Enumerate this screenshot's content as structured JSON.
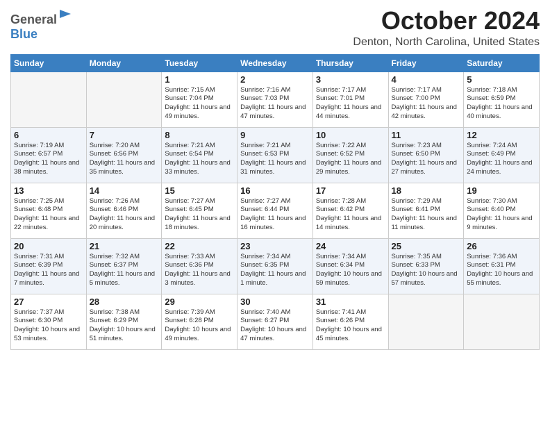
{
  "header": {
    "logo_general": "General",
    "logo_blue": "Blue",
    "month_title": "October 2024",
    "location": "Denton, North Carolina, United States"
  },
  "weekdays": [
    "Sunday",
    "Monday",
    "Tuesday",
    "Wednesday",
    "Thursday",
    "Friday",
    "Saturday"
  ],
  "weeks": [
    [
      {
        "day": "",
        "info": ""
      },
      {
        "day": "",
        "info": ""
      },
      {
        "day": "1",
        "info": "Sunrise: 7:15 AM\nSunset: 7:04 PM\nDaylight: 11 hours and 49 minutes."
      },
      {
        "day": "2",
        "info": "Sunrise: 7:16 AM\nSunset: 7:03 PM\nDaylight: 11 hours and 47 minutes."
      },
      {
        "day": "3",
        "info": "Sunrise: 7:17 AM\nSunset: 7:01 PM\nDaylight: 11 hours and 44 minutes."
      },
      {
        "day": "4",
        "info": "Sunrise: 7:17 AM\nSunset: 7:00 PM\nDaylight: 11 hours and 42 minutes."
      },
      {
        "day": "5",
        "info": "Sunrise: 7:18 AM\nSunset: 6:59 PM\nDaylight: 11 hours and 40 minutes."
      }
    ],
    [
      {
        "day": "6",
        "info": "Sunrise: 7:19 AM\nSunset: 6:57 PM\nDaylight: 11 hours and 38 minutes."
      },
      {
        "day": "7",
        "info": "Sunrise: 7:20 AM\nSunset: 6:56 PM\nDaylight: 11 hours and 35 minutes."
      },
      {
        "day": "8",
        "info": "Sunrise: 7:21 AM\nSunset: 6:54 PM\nDaylight: 11 hours and 33 minutes."
      },
      {
        "day": "9",
        "info": "Sunrise: 7:21 AM\nSunset: 6:53 PM\nDaylight: 11 hours and 31 minutes."
      },
      {
        "day": "10",
        "info": "Sunrise: 7:22 AM\nSunset: 6:52 PM\nDaylight: 11 hours and 29 minutes."
      },
      {
        "day": "11",
        "info": "Sunrise: 7:23 AM\nSunset: 6:50 PM\nDaylight: 11 hours and 27 minutes."
      },
      {
        "day": "12",
        "info": "Sunrise: 7:24 AM\nSunset: 6:49 PM\nDaylight: 11 hours and 24 minutes."
      }
    ],
    [
      {
        "day": "13",
        "info": "Sunrise: 7:25 AM\nSunset: 6:48 PM\nDaylight: 11 hours and 22 minutes."
      },
      {
        "day": "14",
        "info": "Sunrise: 7:26 AM\nSunset: 6:46 PM\nDaylight: 11 hours and 20 minutes."
      },
      {
        "day": "15",
        "info": "Sunrise: 7:27 AM\nSunset: 6:45 PM\nDaylight: 11 hours and 18 minutes."
      },
      {
        "day": "16",
        "info": "Sunrise: 7:27 AM\nSunset: 6:44 PM\nDaylight: 11 hours and 16 minutes."
      },
      {
        "day": "17",
        "info": "Sunrise: 7:28 AM\nSunset: 6:42 PM\nDaylight: 11 hours and 14 minutes."
      },
      {
        "day": "18",
        "info": "Sunrise: 7:29 AM\nSunset: 6:41 PM\nDaylight: 11 hours and 11 minutes."
      },
      {
        "day": "19",
        "info": "Sunrise: 7:30 AM\nSunset: 6:40 PM\nDaylight: 11 hours and 9 minutes."
      }
    ],
    [
      {
        "day": "20",
        "info": "Sunrise: 7:31 AM\nSunset: 6:39 PM\nDaylight: 11 hours and 7 minutes."
      },
      {
        "day": "21",
        "info": "Sunrise: 7:32 AM\nSunset: 6:37 PM\nDaylight: 11 hours and 5 minutes."
      },
      {
        "day": "22",
        "info": "Sunrise: 7:33 AM\nSunset: 6:36 PM\nDaylight: 11 hours and 3 minutes."
      },
      {
        "day": "23",
        "info": "Sunrise: 7:34 AM\nSunset: 6:35 PM\nDaylight: 11 hours and 1 minute."
      },
      {
        "day": "24",
        "info": "Sunrise: 7:34 AM\nSunset: 6:34 PM\nDaylight: 10 hours and 59 minutes."
      },
      {
        "day": "25",
        "info": "Sunrise: 7:35 AM\nSunset: 6:33 PM\nDaylight: 10 hours and 57 minutes."
      },
      {
        "day": "26",
        "info": "Sunrise: 7:36 AM\nSunset: 6:31 PM\nDaylight: 10 hours and 55 minutes."
      }
    ],
    [
      {
        "day": "27",
        "info": "Sunrise: 7:37 AM\nSunset: 6:30 PM\nDaylight: 10 hours and 53 minutes."
      },
      {
        "day": "28",
        "info": "Sunrise: 7:38 AM\nSunset: 6:29 PM\nDaylight: 10 hours and 51 minutes."
      },
      {
        "day": "29",
        "info": "Sunrise: 7:39 AM\nSunset: 6:28 PM\nDaylight: 10 hours and 49 minutes."
      },
      {
        "day": "30",
        "info": "Sunrise: 7:40 AM\nSunset: 6:27 PM\nDaylight: 10 hours and 47 minutes."
      },
      {
        "day": "31",
        "info": "Sunrise: 7:41 AM\nSunset: 6:26 PM\nDaylight: 10 hours and 45 minutes."
      },
      {
        "day": "",
        "info": ""
      },
      {
        "day": "",
        "info": ""
      }
    ]
  ]
}
